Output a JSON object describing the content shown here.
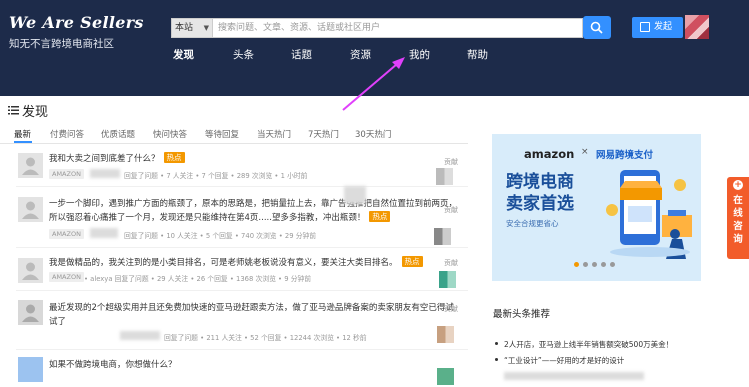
{
  "header": {
    "logo": "We Are Sellers",
    "slogan": "知无不言跨境电商社区",
    "scope": "本站",
    "search_placeholder": "搜索问题、文章、资源、话题或社区用户",
    "post_label": "发起",
    "nav": [
      {
        "label": "发现",
        "active": true
      },
      {
        "label": "头条",
        "active": false
      },
      {
        "label": "话题",
        "active": false
      },
      {
        "label": "资源",
        "active": false
      },
      {
        "label": "我的",
        "active": false
      },
      {
        "label": "帮助",
        "active": false
      }
    ]
  },
  "main": {
    "title": "发现",
    "tabs": [
      "最新",
      "付费问答",
      "优质话题",
      "快问快答",
      "等待回复",
      "当天热门",
      "7天热门",
      "30天热门"
    ],
    "questions": [
      {
        "title": "我和大卖之间到底差了什么？",
        "hot": "热点",
        "tag": "AMAZON",
        "meta": "回复了问题 • 7 人关注 • 7 个回复 • 289 次浏览 • 1 小时前",
        "contrib": "贡献"
      },
      {
        "title_lines": [
          "一步一个脚印，遇到推广方面的瓶颈了，原本的思路是，把销量拉上去，靠广告强推把自然位置拉到前两页，",
          "所以强忍着心痛推了一个月，发现还是只能维持在第4页.....望多多指教，冲出瓶颈！"
        ],
        "hot": "热点",
        "tag": "AMAZON",
        "meta": "回复了问题 • 10 人关注 • 5 个回复 • 740 次浏览 • 29 分钟前",
        "contrib": "贡献"
      },
      {
        "title": "我是做精品的，我关注到的是小类目排名，可是老师姚老板说没有意义，要关注大类目排名。",
        "hot": "热点",
        "tag": "AMAZON",
        "meta": "• alexya 回复了问题 • 29 人关注 • 26 个回复 • 1368 次浏览 • 9 分钟前",
        "contrib": "贡献"
      },
      {
        "title_lines": [
          "最近发现的2个超级实用并且还免费加快速的亚马逊赶跟卖方法，做了亚马逊品牌备案的卖家朋友有空已得试",
          "试了"
        ],
        "meta": "回复了问题 • 211 人关注 • 52 个回复 • 12244 次浏览 • 12 秒前",
        "contrib": "贡献"
      },
      {
        "title": "如果不做跨境电商，你想做什么？"
      }
    ]
  },
  "sidebar": {
    "banner": {
      "brand1": "amazon",
      "times": "×",
      "brand2": "网易跨境支付",
      "line1": "跨境电商",
      "line2": "卖家首选",
      "tagline": "安全合规更省心"
    },
    "news_title": "最新头条推荐",
    "news": [
      "2人开店，亚马逊上线半年销售额突破500万美金！",
      "“工业设计”——好用的才是好的设计"
    ],
    "consult_plus": "+",
    "consult": "在线咨询"
  },
  "colors": {
    "header_bg": "#1d2b4a",
    "accent_blue": "#3390ff",
    "hot_orange": "#f39800",
    "consult_orange": "#f25c2a",
    "annotation_arrow": "#e040fb"
  }
}
